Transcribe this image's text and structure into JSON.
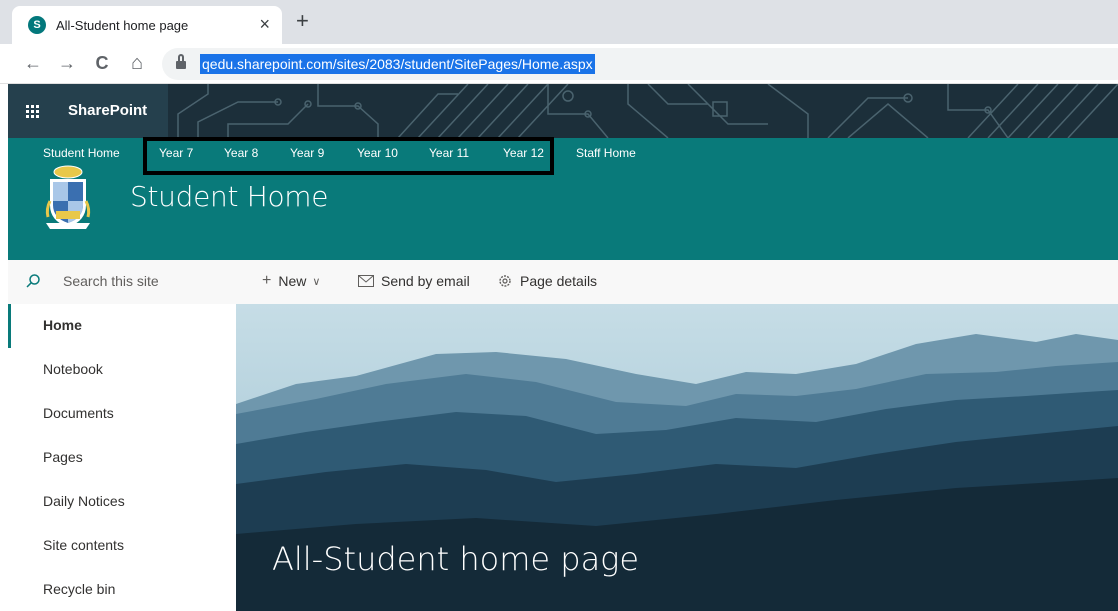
{
  "browser": {
    "tab_title": "All-Student home page",
    "tab_close": "×",
    "new_tab": "+",
    "url": "qedu.sharepoint.com/sites/2083/student/SitePages/Home.aspx",
    "back_icon": "←",
    "forward_icon": "→",
    "reload_icon": "C",
    "home_icon": "⌂"
  },
  "suitebar": {
    "app_name": "SharePoint"
  },
  "site": {
    "title": "Student Home",
    "topnav": [
      "Student Home",
      "Year 7",
      "Year 8",
      "Year 9",
      "Year 10",
      "Year 11",
      "Year 12",
      "Staff Home"
    ]
  },
  "leftnav": {
    "search_placeholder": "Search this site",
    "items": [
      "Home",
      "Notebook",
      "Documents",
      "Pages",
      "Daily Notices",
      "Site contents",
      "Recycle bin"
    ],
    "active": "Home"
  },
  "commandbar": {
    "new_label": "New",
    "email_label": "Send by email",
    "details_label": "Page details"
  },
  "hero": {
    "title": "All-Student home page"
  },
  "colors": {
    "teal": "#097a7a",
    "url_highlight": "#1a73e8",
    "suitebar": "#1c2f3a"
  }
}
